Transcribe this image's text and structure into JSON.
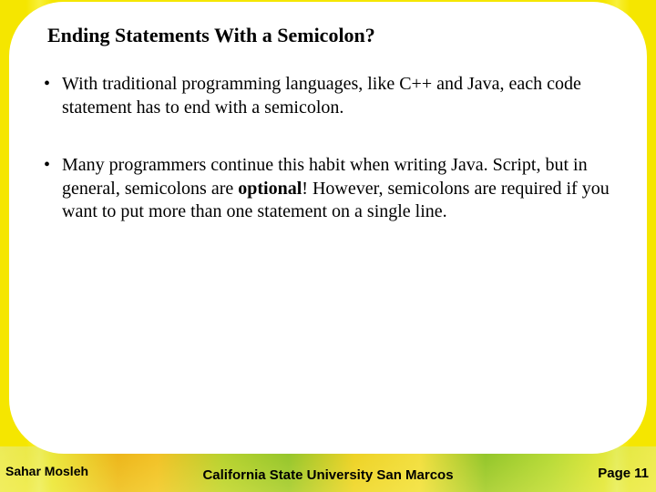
{
  "title": "Ending Statements With a Semicolon?",
  "bullets": [
    {
      "html": "With traditional programming languages, like C++ and Java, each code statement has to end with a semicolon."
    },
    {
      "html": "Many programmers continue this habit when writing Java. Script, but in general, semicolons are <span class=\"bold\">optional</span>! However, semicolons are required if you want to put more than one statement on a single line."
    }
  ],
  "footer": {
    "author": "Sahar Mosleh",
    "university": "California State University San Marcos",
    "page_label": "Page",
    "page_number": "11"
  }
}
